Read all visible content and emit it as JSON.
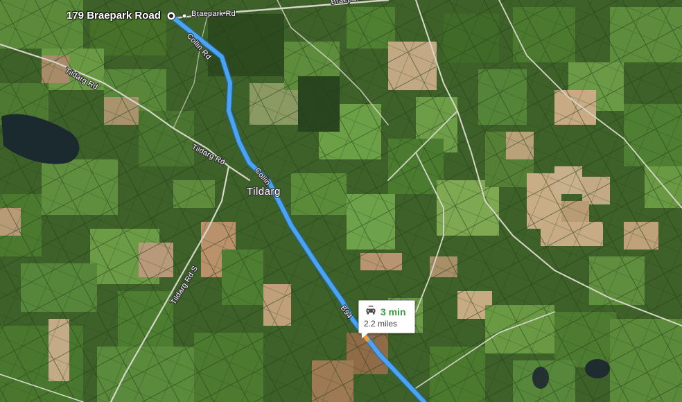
{
  "map": {
    "destination": {
      "name": "179 Braepark Road"
    },
    "place_label": "Tildarg",
    "road_labels": {
      "braepark_top": "Braepark Rd",
      "braepark_top_right": "Braepark Rd",
      "collin_upper": "Collin Rd",
      "collin_middle": "Collin",
      "tildarg_left": "Tildarg Rd",
      "tildarg_center": "Tildarg Rd",
      "tildarg_south": "Tildarg Rd S",
      "b94": "B94"
    },
    "route": {
      "mode_icon": "car-icon",
      "duration": "3 min",
      "distance": "2.2 miles",
      "color": "#4aa3f5",
      "duration_color": "#3a9a3d"
    },
    "colors": {
      "field_dark": "#2f4a22",
      "field_mid": "#4f7a33",
      "field_light": "#7aa64a",
      "field_tan": "#b59a74",
      "water": "#1b2a2f",
      "road": "#d7d7c8"
    }
  }
}
